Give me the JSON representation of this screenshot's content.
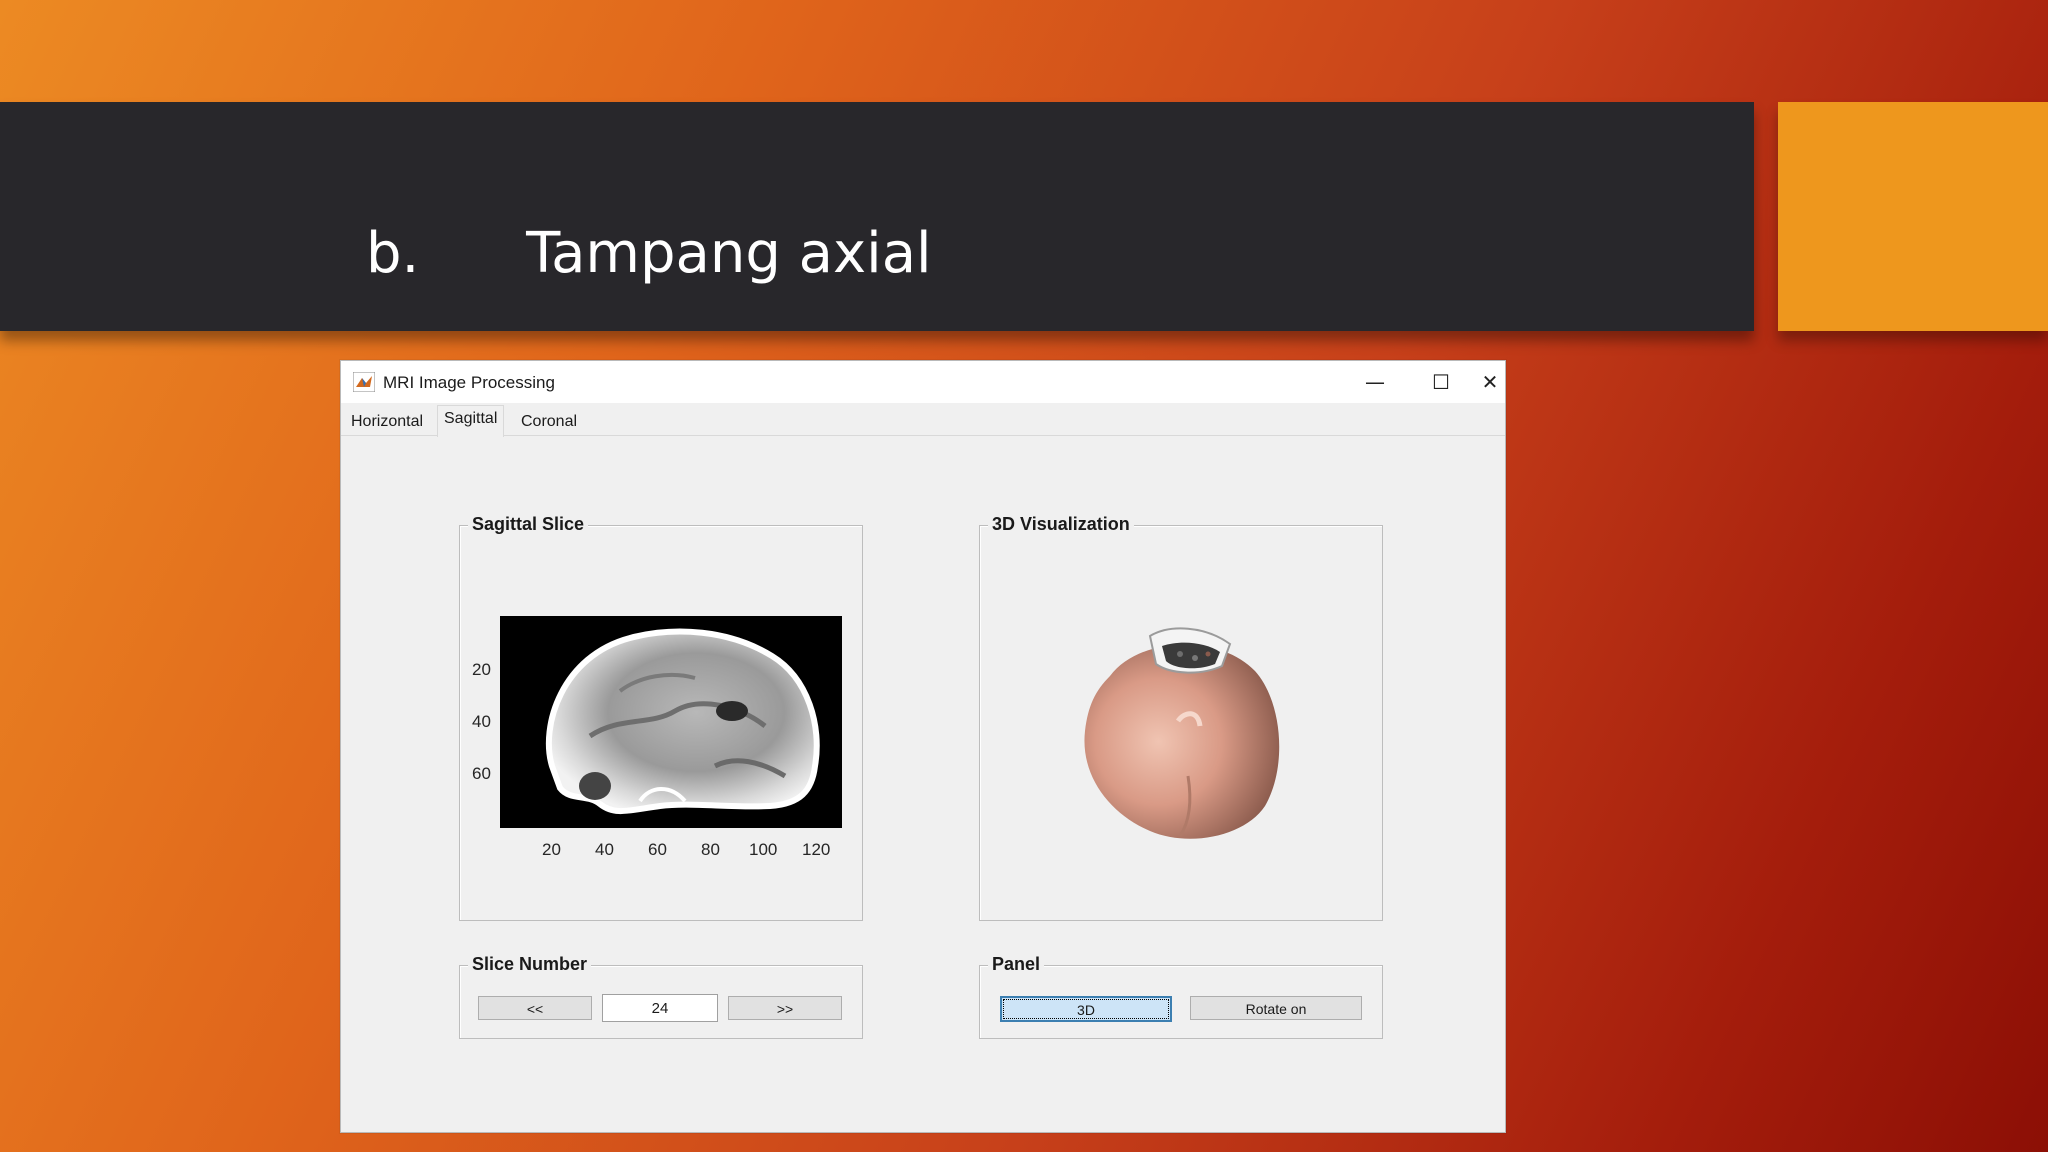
{
  "slide": {
    "title_marker": "b.",
    "title_text": "Tampang axial"
  },
  "window": {
    "title": "MRI Image Processing",
    "controls": {
      "minimize": "—",
      "maximize": "☐",
      "close": "✕"
    }
  },
  "tabs": [
    {
      "label": "Horizontal",
      "active": false
    },
    {
      "label": "Sagittal",
      "active": true
    },
    {
      "label": "Coronal",
      "active": false
    }
  ],
  "sagittal_slice": {
    "label": "Sagittal Slice",
    "y_ticks": [
      "20",
      "40",
      "60"
    ],
    "x_ticks": [
      "20",
      "40",
      "60",
      "80",
      "100",
      "120"
    ]
  },
  "visualization": {
    "label": "3D Visualization"
  },
  "slice_number": {
    "label": "Slice Number",
    "prev_label": "<<",
    "value": "24",
    "next_label": ">>"
  },
  "panel": {
    "label": "Panel",
    "button_3d": "3D",
    "button_rotate": "Rotate on"
  },
  "colors": {
    "title_band": "#28272b",
    "accent": "#ee971d",
    "skin": "#d99a86"
  }
}
